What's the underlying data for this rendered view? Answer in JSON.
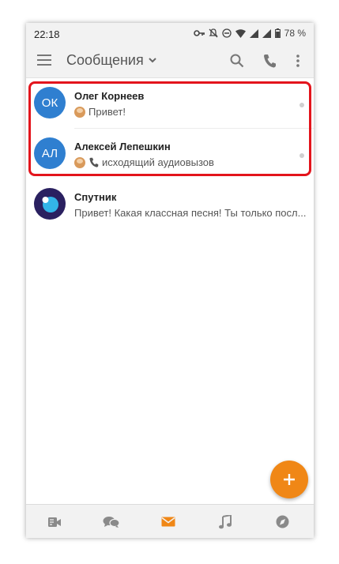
{
  "status_bar": {
    "time": "22:18",
    "battery": "78 %"
  },
  "header": {
    "title": "Сообщения"
  },
  "conversations": [
    {
      "initials": "ОК",
      "name": "Олег Корнеев",
      "preview": "Привет!",
      "avatar_color": "#2f7fd0"
    },
    {
      "initials": "АЛ",
      "name": "Алексей Лепешкин",
      "preview": "исходящий аудиовызов",
      "avatar_color": "#2f7fd0"
    },
    {
      "initials": "",
      "name": "Спутник",
      "preview": "Привет! Какая классная песня! Ты только посл..."
    }
  ],
  "colors": {
    "accent": "#f08716",
    "highlight": "#e3141c",
    "icon_gray": "#8a8a8a"
  },
  "bottom_nav": [
    "video-icon",
    "discussions-icon",
    "messages-icon",
    "music-icon",
    "compass-icon"
  ]
}
